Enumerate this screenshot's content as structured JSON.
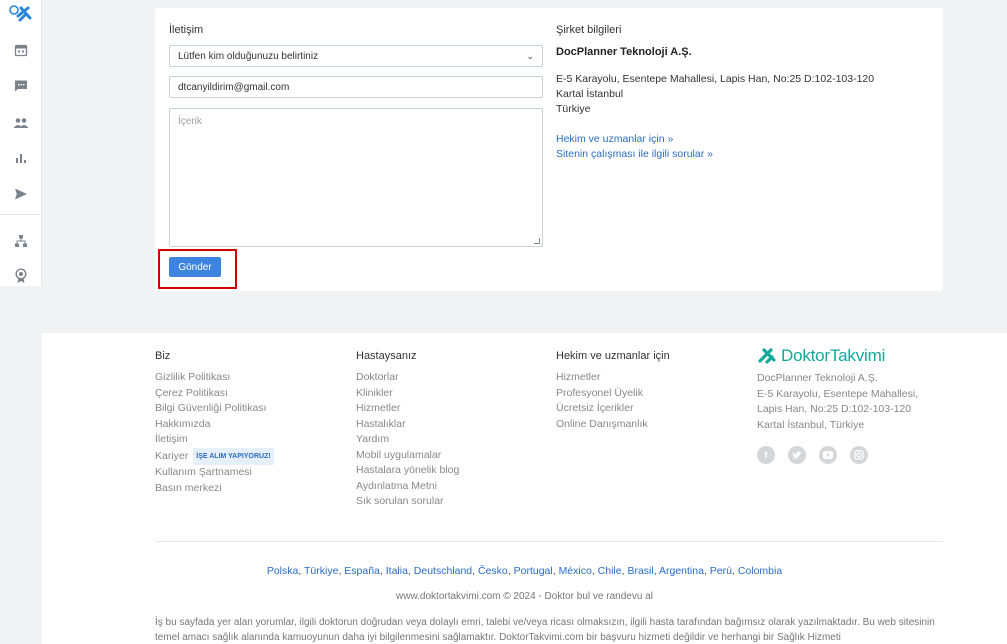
{
  "sidebar": {
    "icons": [
      "doktortakvimi-logo-icon",
      "calendar-icon",
      "chat-icon",
      "users-icon",
      "bar-chart-icon",
      "send-icon",
      "sitemap-icon",
      "award-icon"
    ]
  },
  "contact": {
    "title": "İletişim",
    "select_value": "Lütfen kim olduğunuzu belirtiniz",
    "email_value": "dtcanyildirim@gmail.com",
    "message_placeholder": "İçerik",
    "submit_label": "Gönder"
  },
  "company": {
    "title": "Şirket bilgileri",
    "name": "DocPlanner Teknoloji A.Ş.",
    "address_line1": "E-5 Karayolu, Esentepe Mahallesi, Lapis Han, No:25 D:102-103-120",
    "address_line2": "Kartal İstanbul",
    "address_line3": "Türkiye",
    "link1": "Hekim ve uzmanlar için »",
    "link2": "Sitenin çalışması ile ilgili sorular »"
  },
  "footer": {
    "col_biz": {
      "heading": "Biz",
      "items": [
        "Gizlilik Politikası",
        "Çerez Politikası",
        "Bilgi Güvenliği Politikası",
        "Hakkımızda",
        "İletişim",
        "Kariyer",
        "Kullanım Şartnamesi",
        "Basın merkezi"
      ],
      "badge": "İŞE ALIM YAPIYORUZ!"
    },
    "col_patient": {
      "heading": "Hastaysanız",
      "items": [
        "Doktorlar",
        "Klinikler",
        "Hizmetler",
        "Hastalıklar",
        "Yardım",
        "Mobil uygulamalar",
        "Hastalara yönelik blog",
        "Aydınlatma Metni",
        "Sık sorulan sorular"
      ]
    },
    "col_doctor": {
      "heading": "Hekim ve uzmanlar için",
      "items": [
        "Hizmetler",
        "Profesyonel Üyelik",
        "Ücretsiz İçerikler",
        "Online Danışmanlık"
      ]
    },
    "brand": {
      "name": "DoktorTakvimi",
      "address": [
        "DocPlanner Teknoloji A.Ş.",
        "E-5 Karayolu, Esentepe Mahallesi,",
        "Lapis Han, No:25 D:102-103-120",
        "Kartal İstanbul, Türkiye"
      ],
      "socials": [
        "facebook-icon",
        "twitter-icon",
        "youtube-icon",
        "instagram-icon"
      ]
    },
    "countries": [
      "Polska",
      "Türkiye",
      "España",
      "Italia",
      "Deutschland",
      "Česko",
      "Portugal",
      "México",
      "Chile",
      "Brasil",
      "Argentina",
      "Perú",
      "Colombia"
    ],
    "copyright": "www.doktortakvimi.com © 2024 - Doktor bul ve randevu al",
    "disclaimer": "İş bu sayfada yer alan yorumlar, ilgili doktorun doğrudan veya dolaylı emri, talebi ve/veya ricası olmaksızın, ilgili hasta tarafından bağımsız olarak yazılmaktadır. Bu web sitesinin temel amacı sağlık alanında kamuoyunun daha iyi bilgilenmesini sağlamaktır. DoktorTakvimi.com bir başvuru hizmeti değildir ve herhangi bir Sağlık Hizmeti"
  },
  "colors": {
    "accent": "#3d84e0",
    "brand": "#12a99a",
    "link": "#2a6cc7",
    "highlight": "#d30000"
  }
}
